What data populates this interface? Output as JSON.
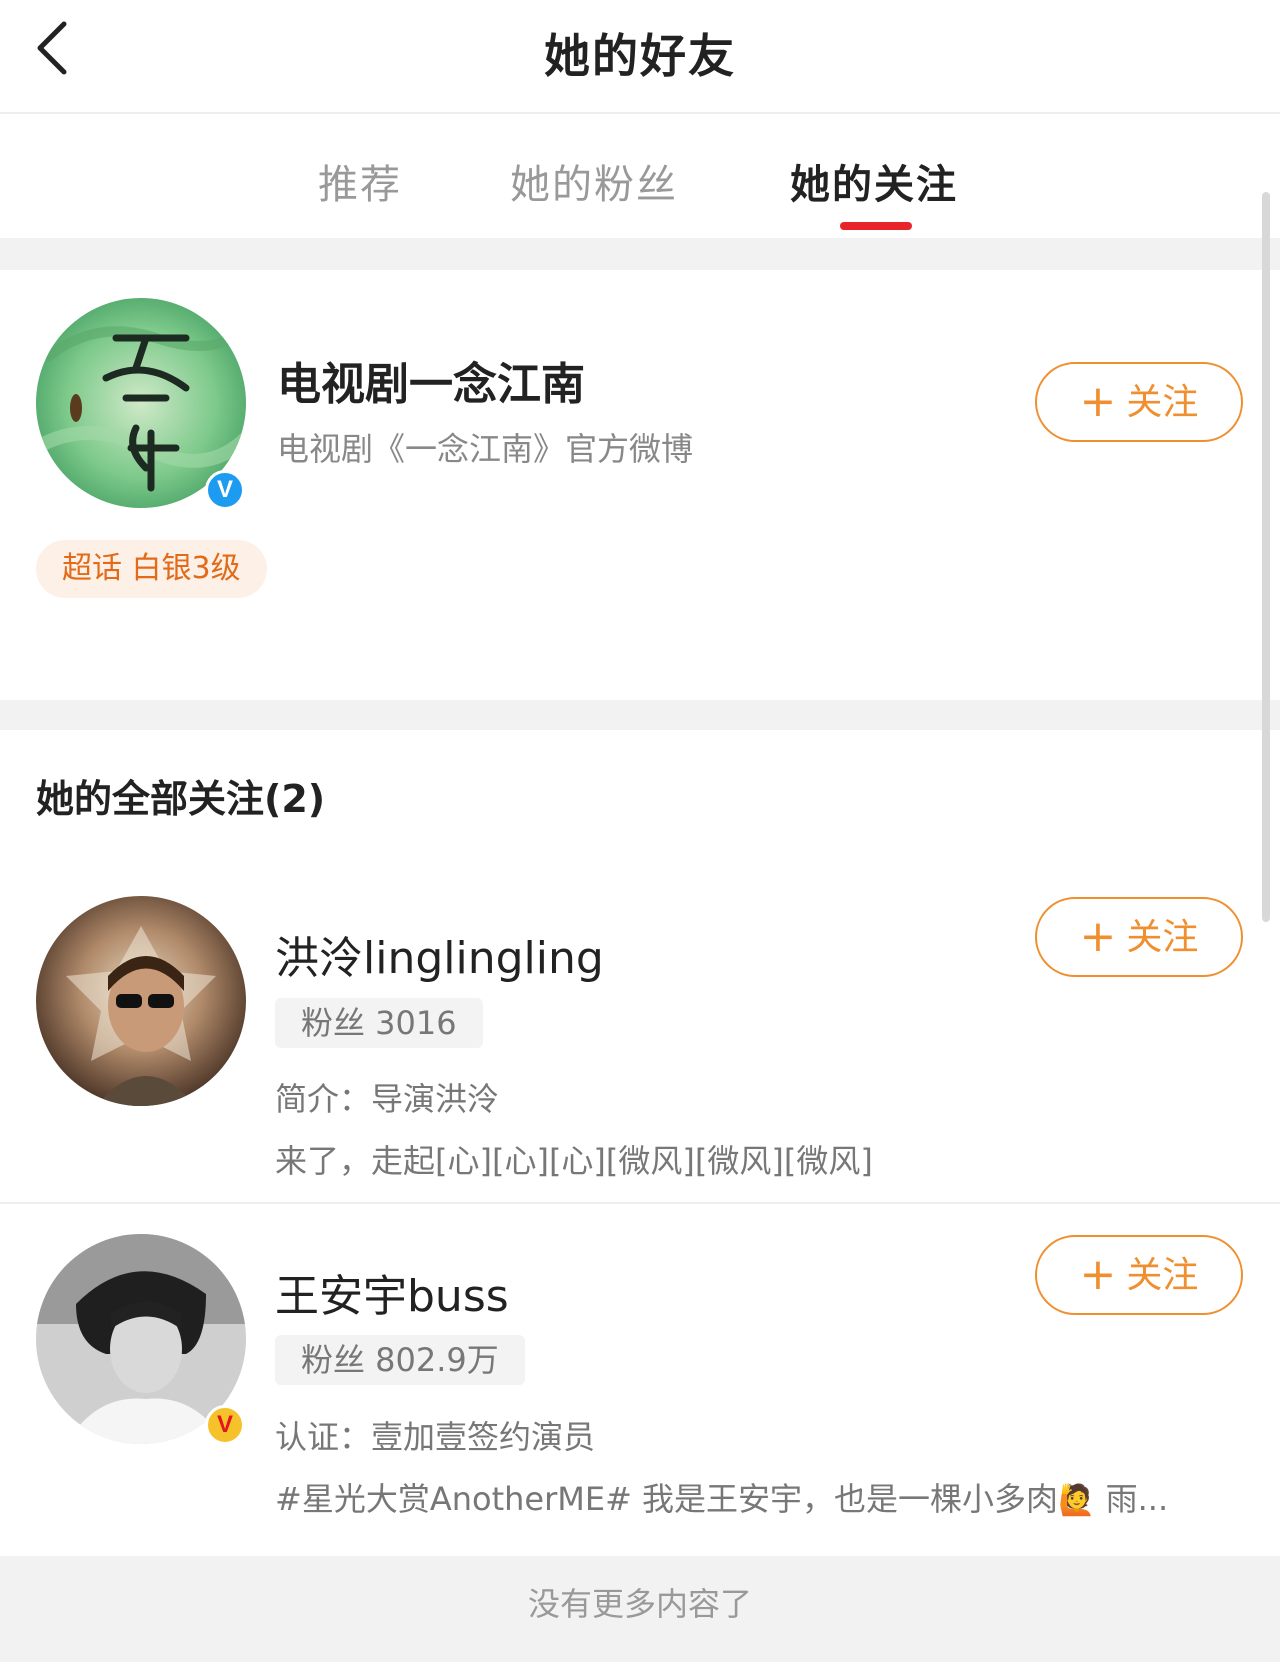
{
  "header": {
    "title": "她的好友",
    "back_icon": "chevron-left-icon"
  },
  "tabs": [
    {
      "label": "推荐",
      "active": false
    },
    {
      "label": "她的粉丝",
      "active": false
    },
    {
      "label": "她的关注",
      "active": true
    }
  ],
  "featured": {
    "name": "电视剧一念江南",
    "description": "电视剧《一念江南》官方微博",
    "verified_icon": "blue-verified-icon",
    "badge": "超话 白银3级",
    "follow_label": "关注"
  },
  "section": {
    "title": "她的全部关注(2)"
  },
  "users": [
    {
      "name": "洪泠linglingling",
      "fans": "粉丝 3016",
      "intro": "简介：导演洪泠",
      "latest": "来了，走起[心][心][心][微风][微风][微风]",
      "follow_label": "关注"
    },
    {
      "name": "王安宇buss",
      "fans": "粉丝 802.9万",
      "intro": "认证：壹加壹签约演员",
      "latest": "#星光大赏AnotherME# 我是王安宇，也是一棵小多肉",
      "latest_emoji": "🙋",
      "latest_tail": " 雨...",
      "verified_icon": "gold-verified-icon",
      "follow_label": "关注"
    }
  ],
  "footer": {
    "text": "没有更多内容了"
  },
  "colors": {
    "accent": "#f08f2f",
    "tab_indicator": "#e8232a",
    "badge_text": "#e26a18",
    "verified_blue": "#1d9bf0"
  }
}
